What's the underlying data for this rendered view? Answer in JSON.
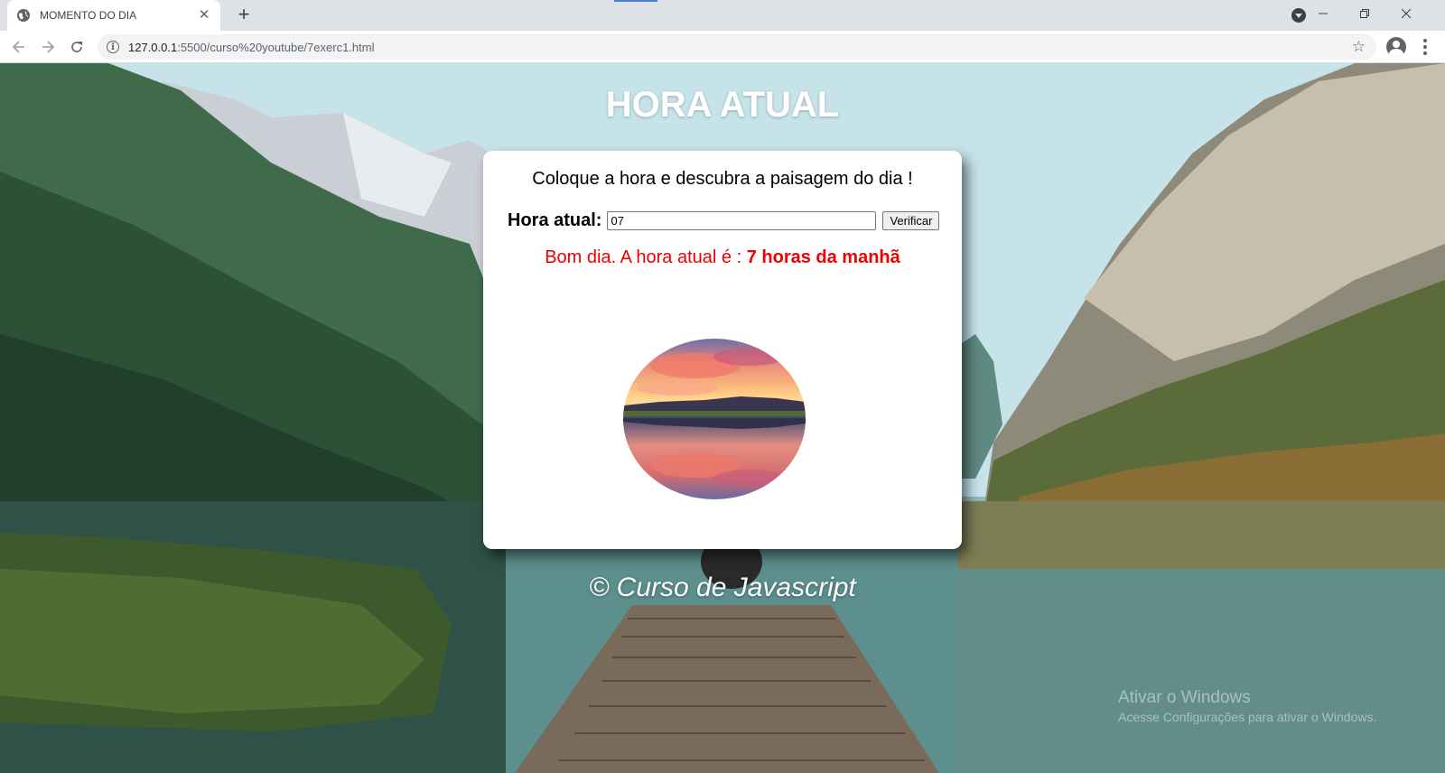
{
  "browser": {
    "tab_title": "MOMENTO DO DIA",
    "tab_close": "✕",
    "new_tab": "+",
    "url_host": "127.0.0.1",
    "url_path": ":5500/curso%20youtube/7exerc1.html",
    "icons": {
      "favicon": "globe-icon",
      "back": "arrow-left-icon",
      "forward": "arrow-right-icon",
      "reload": "reload-icon",
      "info": "info-icon",
      "bookmark": "star-icon",
      "profile": "profile-icon",
      "menu": "kebab-menu-icon",
      "tab_search": "tab-search-icon"
    }
  },
  "page": {
    "title": "HORA ATUAL",
    "prompt": "Coloque a hora e descubra a paisagem do dia !",
    "hour_label": "Hora atual:",
    "hour_value": "07",
    "verify_button": "Verificar",
    "result_prefix": "Bom dia. A hora atual é : ",
    "result_emphasis": "7 horas da manhã",
    "footer": "© Curso de Javascript"
  },
  "watermark": {
    "title": "Ativar o Windows",
    "subtitle": "Acesse Configurações para ativar o Windows."
  },
  "colors": {
    "result_text": "#f00000",
    "title_text": "#ffffff",
    "card_bg": "#ffffff"
  }
}
